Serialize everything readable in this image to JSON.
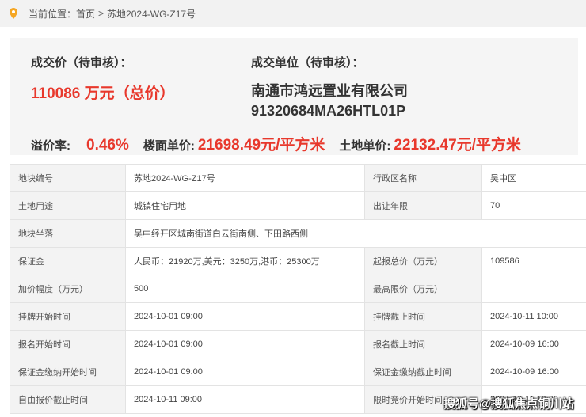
{
  "breadcrumb": {
    "prefix": "当前位置：",
    "home": "首页",
    "separator": ">",
    "current": "苏地2024-WG-Z17号"
  },
  "summary": {
    "price_label": "成交价（待审核）：",
    "price_value": "110086 万元（总价）",
    "buyer_label": "成交单位（待审核）：",
    "buyer_name": "南通市鸿远置业有限公司",
    "buyer_code": "91320684MA26HTL01P",
    "premium_label": "溢价率:",
    "premium_value": "0.46%",
    "floor_price_label": "楼面单价:",
    "floor_price_value": "21698.49元/平方米",
    "land_price_label": "土地单价:",
    "land_price_value": "22132.47元/平方米"
  },
  "table": [
    {
      "k1": "地块编号",
      "v1": "苏地2024-WG-Z17号",
      "k2": "行政区名称",
      "v2": "吴中区"
    },
    {
      "k1": "土地用途",
      "v1": "城镇住宅用地",
      "k2": "出让年限",
      "v2": "70"
    },
    {
      "k1": "地块坐落",
      "v1": "吴中经开区城南街道白云街南侧、下田路西侧"
    },
    {
      "k1": "保证金",
      "v1": "人民币：21920万,美元：3250万,港币：25300万",
      "k2": "起报总价（万元）",
      "v2": "109586"
    },
    {
      "k1": "加价幅度（万元）",
      "v1": "500",
      "k2": "最高限价（万元）",
      "v2": ""
    },
    {
      "k1": "挂牌开始时间",
      "v1": "2024-10-01 09:00",
      "k2": "挂牌截止时间",
      "v2": "2024-10-11 10:00"
    },
    {
      "k1": "报名开始时间",
      "v1": "2024-10-01 09:00",
      "k2": "报名截止时间",
      "v2": "2024-10-09 16:00"
    },
    {
      "k1": "保证金缴纳开始时间",
      "v1": "2024-10-01 09:00",
      "k2": "保证金缴纳截止时间",
      "v2": "2024-10-09 16:00"
    },
    {
      "k1": "自由报价截止时间",
      "v1": "2024-10-11 09:00",
      "k2": "限时竞价开始时间",
      "v2": "2024-10-11 10:00"
    }
  ],
  "watermark": "搜狐号@搜狐焦点铜川站",
  "colors": {
    "accent_red": "#e8382c",
    "pin_orange": "#f5a623"
  },
  "icons": {
    "location": "location-pin-icon"
  }
}
